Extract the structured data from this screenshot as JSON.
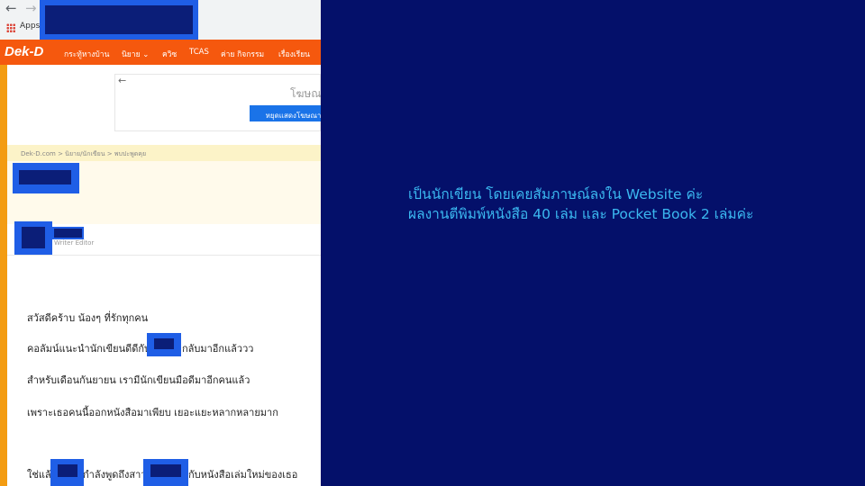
{
  "browser": {
    "apps_label": "Apps"
  },
  "site": {
    "logo": "Dek-D",
    "nav_items": [
      "กระทู้หางบ้าน",
      "นิยาย ⌄",
      "ควิซ",
      "TCAS",
      "ค่าย กิจกรรม",
      "เรื่องเรียน"
    ]
  },
  "ad": {
    "title": "โฆษณ",
    "button_label": "หยุดแสดงโฆษณา"
  },
  "article": {
    "breadcrumb": "Dek-D.com > นิยาย/นักเขียน > พบปะพูดคุย",
    "author_role": "Writer Editor",
    "paragraphs": [
      "สวัสดีคร้าบ น้องๆ ที่รักทุกคน",
      "คอลัมน์แนะนำนักเขียนดีดีกับ",
      "กลับมาอีกแล้ววว",
      "สำหรับเดือนกันยายน เรามีนักเขียนมือดีมาอีกคนแล้ว",
      "เพราะเธอคนนี้ออกหนังสือมาเพียบ เยอะแยะหลากหลายมาก",
      "ใช่แล้ว",
      "กำลังพูดถึงสาว",
      "กับหนังสือเล่มใหม่ของเธอ"
    ]
  },
  "caption": {
    "line1": "เป็นนักเขียน โดยเคยสัมภาษณ์ลงใน Website ค่ะ",
    "line2": "ผลงานตีพิมพ์หนังสือ 40 เล่ม และ Pocket Book 2 เล่มค่ะ"
  },
  "colors": {
    "background": "#04106a",
    "caption_text": "#3bb8f0",
    "site_orange": "#f5580e",
    "redaction_blue": "#1f5ee6"
  }
}
